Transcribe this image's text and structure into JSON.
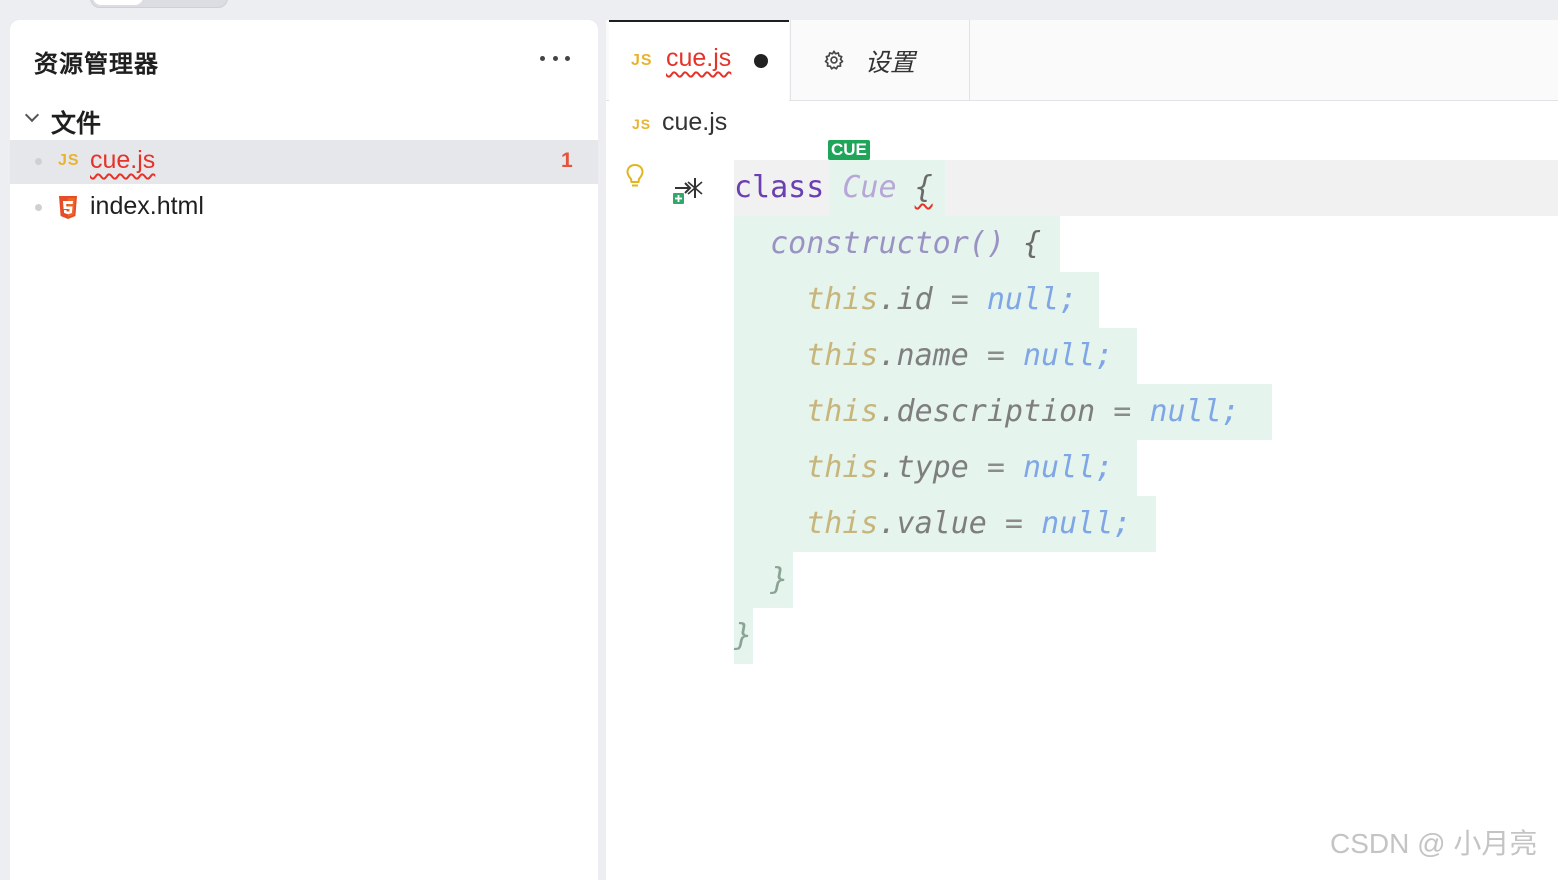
{
  "sidebar": {
    "title": "资源管理器",
    "folder": "文件",
    "files": [
      {
        "icon": "JS",
        "name": "cue.js",
        "problems": "1"
      },
      {
        "name": "index.html"
      }
    ]
  },
  "editor": {
    "tabs": [
      {
        "icon": "JS",
        "label": "cue.js",
        "unsaved": true
      },
      {
        "label": "设置"
      }
    ],
    "breadcrumb": {
      "icon": "JS",
      "file": "cue.js"
    },
    "cue_tag": "CUE",
    "code": {
      "l1": {
        "kw": "class",
        "name": "Cue",
        "brace": "{"
      },
      "l2": {
        "fn": "constructor()",
        "brace": "{"
      },
      "fields": [
        {
          "this": "this",
          "prop": ".id",
          "op": " = ",
          "val": "null;"
        },
        {
          "this": "this",
          "prop": ".name",
          "op": " = ",
          "val": "null;"
        },
        {
          "this": "this",
          "prop": ".description",
          "op": " = ",
          "val": "null;"
        },
        {
          "this": "this",
          "prop": ".type",
          "op": " = ",
          "val": "null;"
        },
        {
          "this": "this",
          "prop": ".value",
          "op": " = ",
          "val": "null;"
        }
      ],
      "close_inner": "}",
      "close_outer": "}"
    }
  },
  "watermark": "CSDN @ 小月亮",
  "colors": {
    "error": "#e5332a",
    "js_icon": "#e8b32f",
    "html_icon": "#e44d26",
    "added_highlight": "#e5f4ec",
    "cue_tag": "#1fa55a"
  }
}
